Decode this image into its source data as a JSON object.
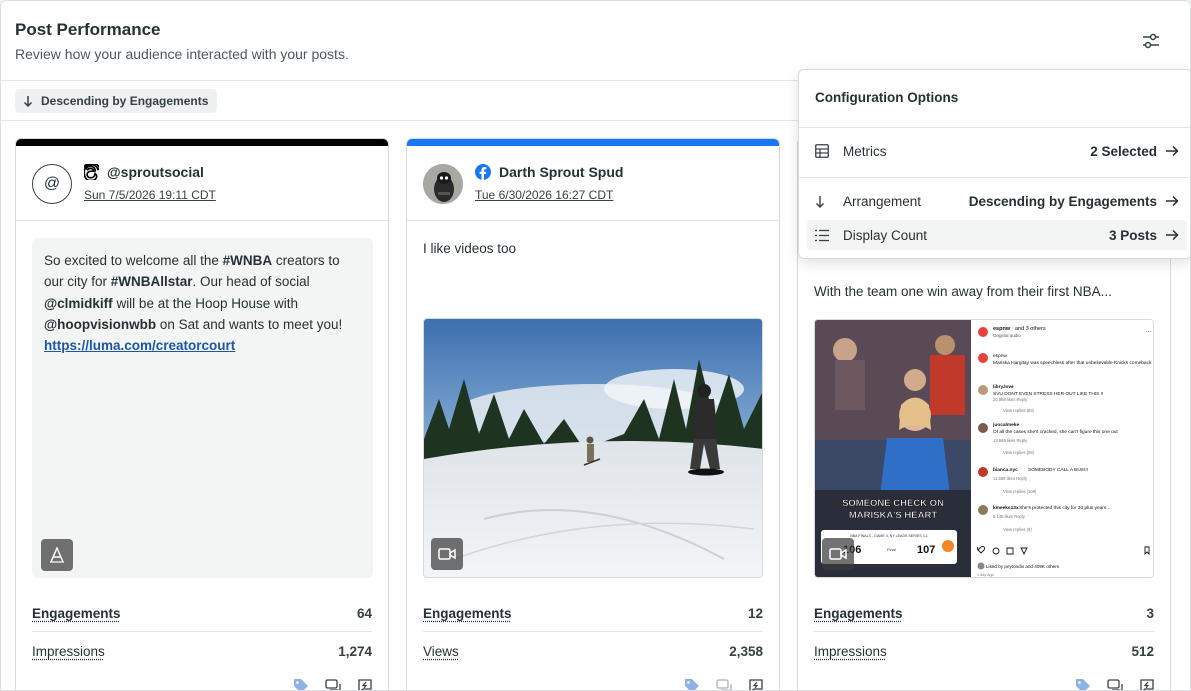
{
  "header": {
    "title": "Post Performance",
    "subtitle": "Review how your audience interacted with your posts."
  },
  "sort_chip": {
    "label": "Descending by Engagements"
  },
  "config": {
    "title": "Configuration Options",
    "rows": [
      {
        "label": "Metrics",
        "value": "2 Selected"
      },
      {
        "label": "Arrangement",
        "value": "Descending by Engagements"
      },
      {
        "label": "Display Count",
        "value": "3 Posts"
      }
    ]
  },
  "posts": [
    {
      "network": "threads",
      "accent": "#000000",
      "avatar_text": "@",
      "author": "@sproutsocial",
      "date": "Sun 7/5/2026 19:11 CDT",
      "text_parts": [
        {
          "t": "So excited to welcome all the ",
          "b": false
        },
        {
          "t": "#WNBA",
          "b": true
        },
        {
          "t": " creators to our city for ",
          "b": false
        },
        {
          "t": "#WNBAllstar",
          "b": true
        },
        {
          "t": ". Our head of social ",
          "b": false
        },
        {
          "t": "@clmidkiff",
          "b": true
        },
        {
          "t": " will be at the Hoop House with ",
          "b": false
        },
        {
          "t": "@hoopvisionwbb",
          "b": true
        },
        {
          "t": " on Sat and wants to meet you! ",
          "b": false
        }
      ],
      "link": "https://luma.com/creatorcourt",
      "metrics": [
        {
          "label": "Engagements",
          "value": "64"
        },
        {
          "label": "Impressions",
          "value": "1,274"
        }
      ]
    },
    {
      "network": "facebook",
      "accent": "#1877f2",
      "author": "Darth Sprout Spud",
      "date": "Tue 6/30/2026 16:27 CDT",
      "text": "I like videos too",
      "metrics": [
        {
          "label": "Engagements",
          "value": "12"
        },
        {
          "label": "Views",
          "value": "2,358"
        }
      ]
    },
    {
      "text": "With the team one win away from their first NBA...",
      "overlay": {
        "caption_line1": "SOMEONE CHECK ON",
        "caption_line2": "MARISKA'S HEART",
        "score_left": "106",
        "score_right": "107",
        "score_status": "Final",
        "score_title": "NBA FINALS - GAME 4, NY LEADS SERIES 3-1",
        "comment_header": "espnw",
        "comment_header_tail": "and 3 others",
        "comment_header_sub": "Original audio",
        "comments": [
          {
            "user": "espnw",
            "text": "Mariska Hargitay was speechless after that unbelievable Knicks comeback"
          },
          {
            "user": "libry.love",
            "text": "SVU DONT EVEN STRESS HER OUT LIKE THIS !!",
            "meta": "20,958 likes  Reply",
            "replies": "View replies (83)"
          },
          {
            "user": "juocalmeke",
            "text": "Of all the cases she's cracked, she can't figure this one out",
            "meta": "13,586 likes  Reply",
            "replies": "View replies (59)"
          },
          {
            "user": "bianca.nyc",
            "text": "SOMEBODY CALL A BUS!!!",
            "meta": "11,689 likes  Reply",
            "replies": "View replies (109)"
          },
          {
            "user": "kmeeks13x",
            "text": "She's protected this city for 30 plus years...",
            "meta": "8,148 likes  Reply",
            "replies": "View replies (9)"
          }
        ],
        "liked_by": "Liked by peytondix and 409K others",
        "age": "1 day ago"
      },
      "metrics": [
        {
          "label": "Engagements",
          "value": "3"
        },
        {
          "label": "Impressions",
          "value": "512"
        }
      ]
    }
  ],
  "colors": {
    "tag_blue": "#8fb2e6",
    "link_blue": "#1d56a8",
    "threads_black": "#000000",
    "facebook_blue": "#1877f2"
  }
}
